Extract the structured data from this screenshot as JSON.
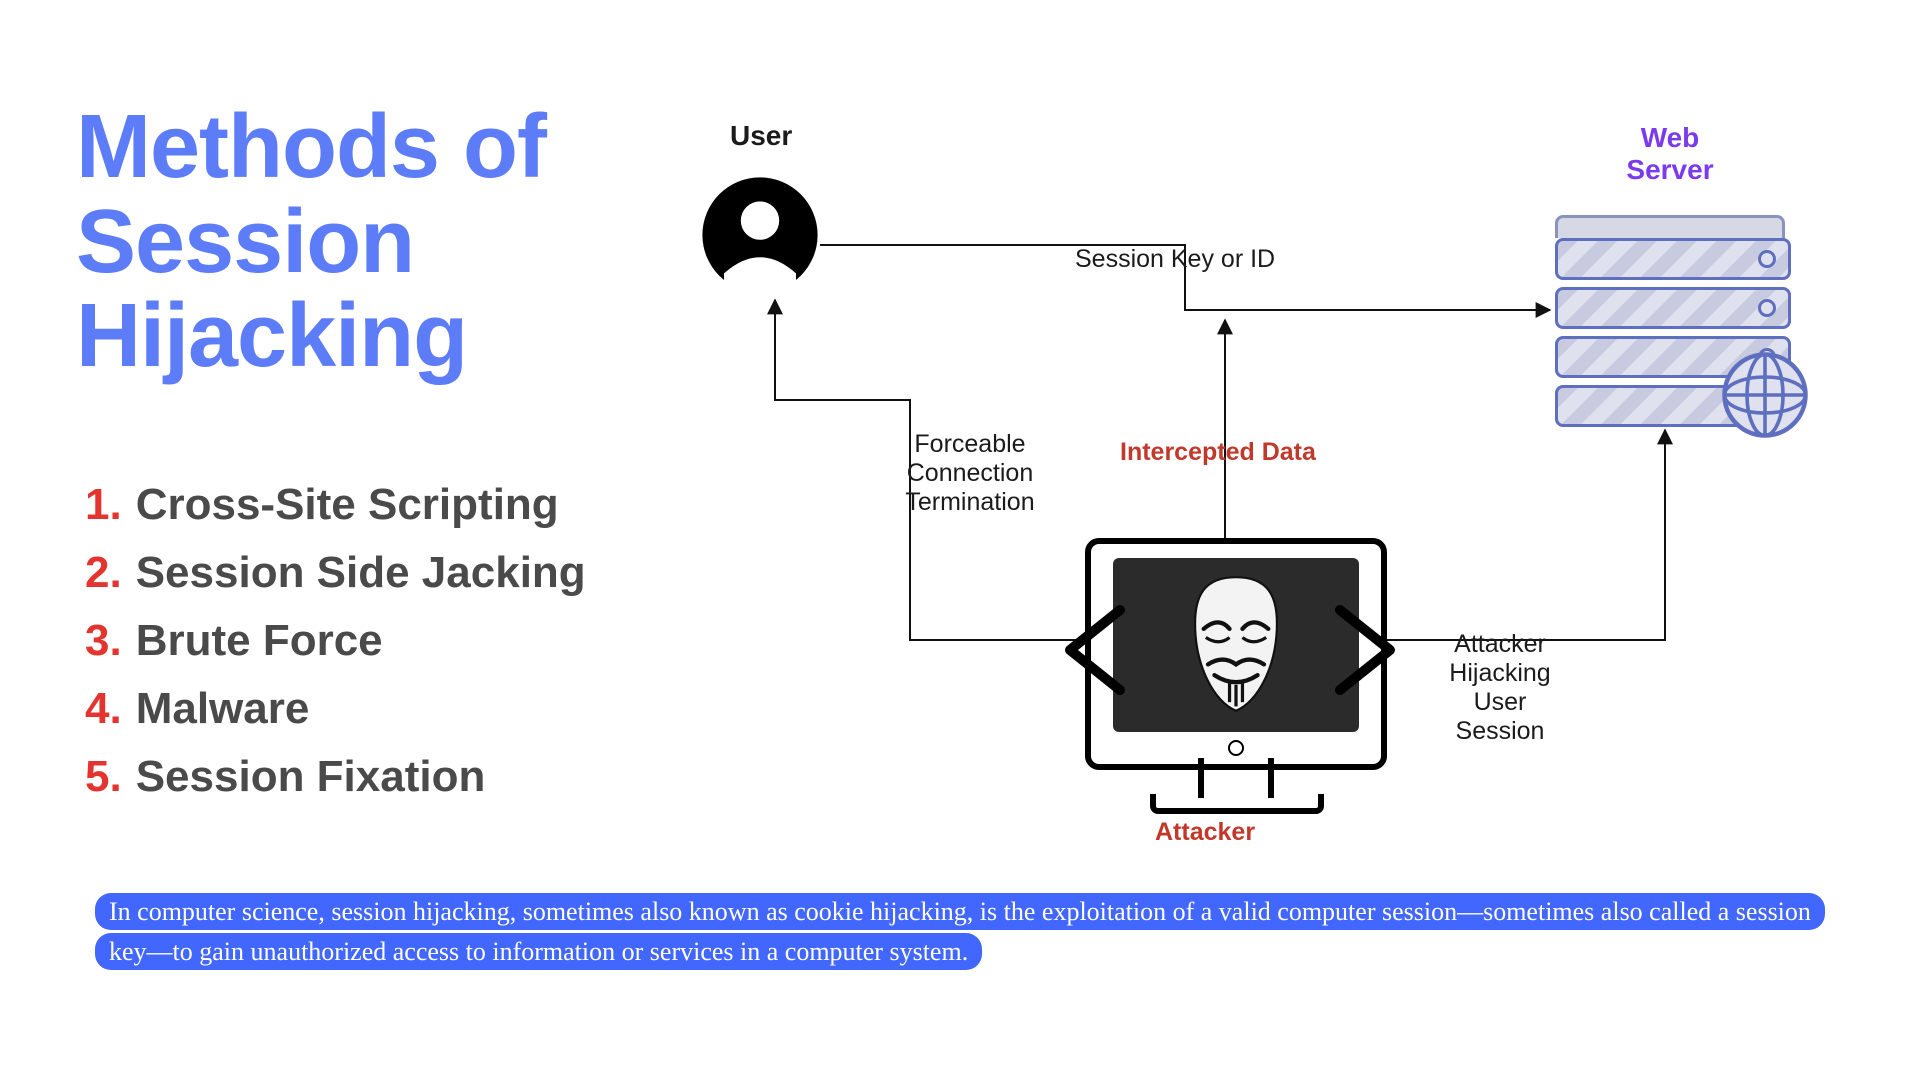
{
  "title_line1": "Methods of",
  "title_line2": "Session",
  "title_line3": "Hijacking",
  "methods": [
    {
      "n": "1.",
      "t": "Cross-Site Scripting"
    },
    {
      "n": "2.",
      "t": "Session Side Jacking"
    },
    {
      "n": "3.",
      "t": "Brute Force"
    },
    {
      "n": "4.",
      "t": "Malware"
    },
    {
      "n": "5.",
      "t": "Session Fixation"
    }
  ],
  "labels": {
    "user": "User",
    "webserver_l1": "Web",
    "webserver_l2": "Server",
    "session_key": "Session Key or ID",
    "forceable_l1": "Forceable",
    "forceable_l2": "Connection",
    "forceable_l3": "Termination",
    "intercepted": "Intercepted Data",
    "attacker": "Attacker",
    "hijack_l1": "Attacker",
    "hijack_l2": "Hijacking",
    "hijack_l3": "User",
    "hijack_l4": "Session"
  },
  "footer": "In computer science, session hijacking, sometimes also known as cookie hijacking, is the exploitation of a valid computer session—sometimes also called a session key—to gain unauthorized access to information or services in a computer system.",
  "colors": {
    "accent": "#5d7cf7",
    "red": "#e3342f",
    "purple": "#7c3aed",
    "danger": "#c0392b",
    "footer_bg": "#4267ff"
  }
}
